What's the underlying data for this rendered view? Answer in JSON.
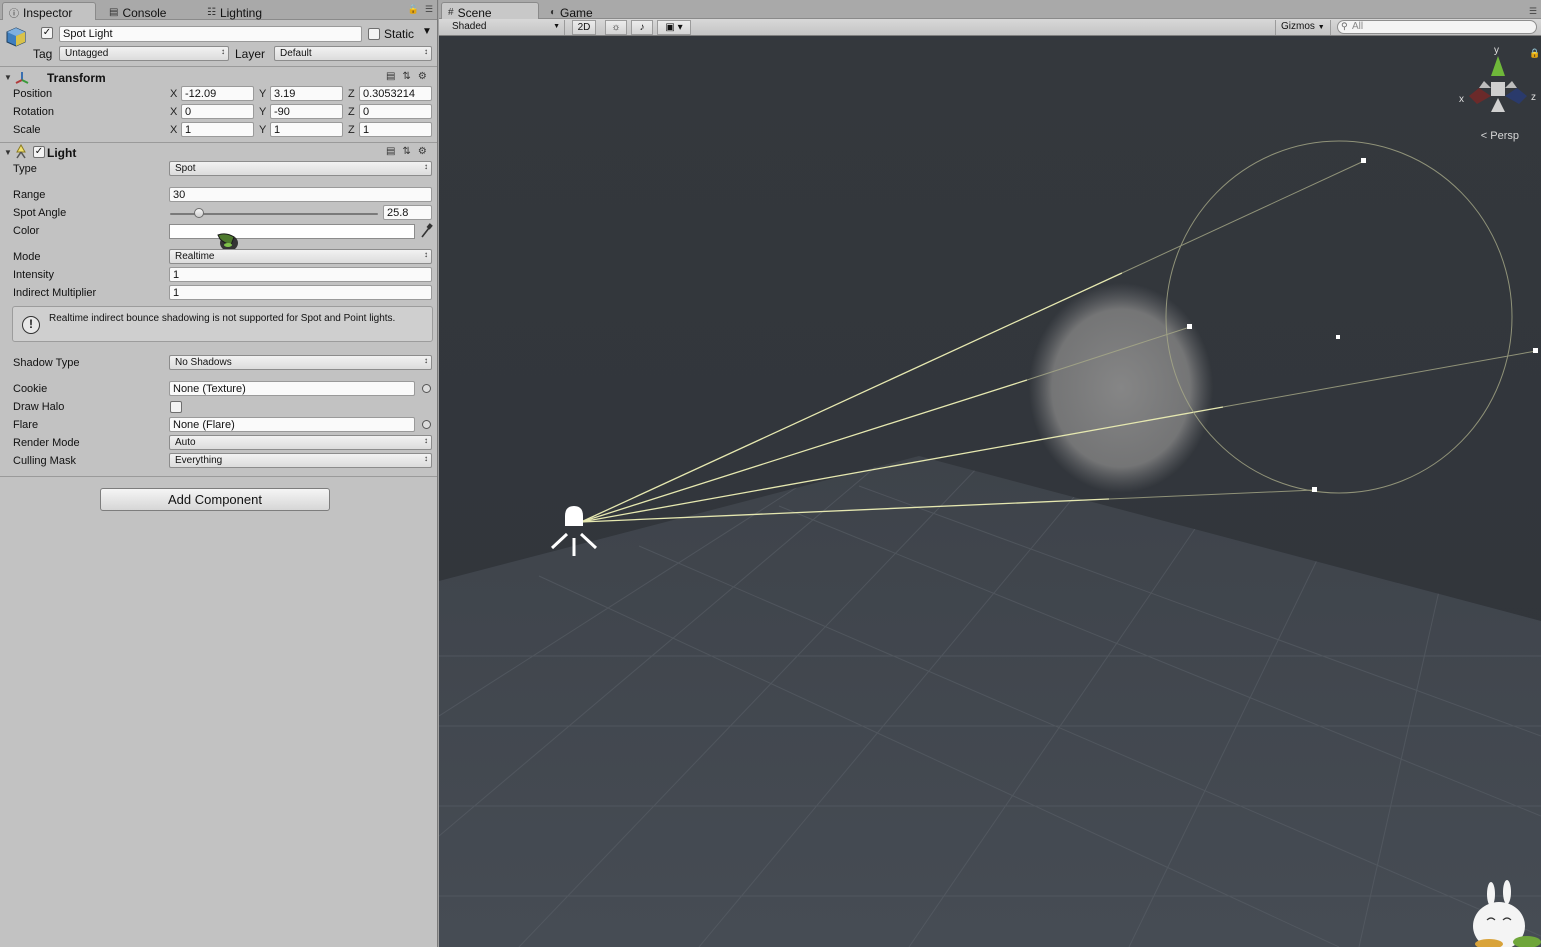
{
  "inspector_tabs": [
    {
      "label": "Inspector",
      "icon": "info-icon"
    },
    {
      "label": "Console",
      "icon": "console-icon"
    },
    {
      "label": "Lighting",
      "icon": "lighting-icon"
    }
  ],
  "object": {
    "active": true,
    "name": "Spot Light",
    "static_label": "Static",
    "static": false,
    "tag_label": "Tag",
    "tag": "Untagged",
    "layer_label": "Layer",
    "layer": "Default"
  },
  "transform": {
    "title": "Transform",
    "position_label": "Position",
    "rotation_label": "Rotation",
    "scale_label": "Scale",
    "axes": [
      "X",
      "Y",
      "Z"
    ],
    "position": [
      "-12.09",
      "3.19",
      "0.3053214"
    ],
    "rotation": [
      "0",
      "-90",
      "0"
    ],
    "scale": [
      "1",
      "1",
      "1"
    ]
  },
  "light": {
    "title": "Light",
    "enabled": true,
    "type_label": "Type",
    "type": "Spot",
    "range_label": "Range",
    "range": "30",
    "spot_angle_label": "Spot Angle",
    "spot_angle": "25.8",
    "spot_angle_fraction": 0.14,
    "color_label": "Color",
    "color_value": "#ffffff",
    "mode_label": "Mode",
    "mode": "Realtime",
    "intensity_label": "Intensity",
    "intensity": "1",
    "indirect_label": "Indirect Multiplier",
    "indirect": "1",
    "help_message": "Realtime indirect bounce shadowing is not supported for Spot and Point lights.",
    "shadow_type_label": "Shadow Type",
    "shadow_type": "No Shadows",
    "cookie_label": "Cookie",
    "cookie": "None (Texture)",
    "draw_halo_label": "Draw Halo",
    "draw_halo": false,
    "flare_label": "Flare",
    "flare": "None (Flare)",
    "render_mode_label": "Render Mode",
    "render_mode": "Auto",
    "culling_mask_label": "Culling Mask",
    "culling_mask": "Everything"
  },
  "add_component_label": "Add Component",
  "scene_tabs": [
    {
      "label": "Scene",
      "icon": "grid-icon"
    },
    {
      "label": "Game",
      "icon": "pacman-icon"
    }
  ],
  "scene_toolbar": {
    "shading": "Shaded",
    "mode_2d": "2D",
    "gizmos": "Gizmos",
    "search_placeholder": "All"
  },
  "gizmo": {
    "x": "x",
    "y": "y",
    "z": "z",
    "projection": "Persp"
  },
  "colors": {
    "panel_bg": "#c2c2c2",
    "scene_bg": "#2f3338",
    "light_gizmo": "#e6e8b0"
  }
}
